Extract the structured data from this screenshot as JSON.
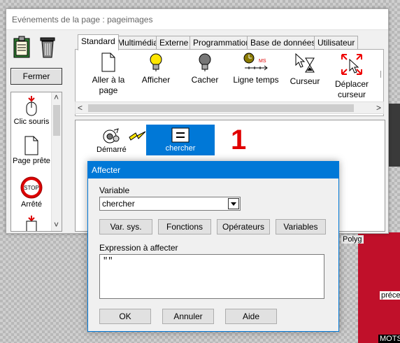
{
  "background": {
    "right_labels": [
      "Polyg",
      "préce",
      "MOTS"
    ]
  },
  "main_window": {
    "title": "Evénements de la page : pageimages",
    "fermer_label": "Fermer",
    "tabs": [
      "Standard",
      "Multimédia",
      "Externe",
      "Programmation",
      "Base de données",
      "Utilisateur"
    ],
    "tools": [
      {
        "label": "Aller à la page",
        "icon": "page-icon"
      },
      {
        "label": "Afficher",
        "icon": "lightbulb-on-icon"
      },
      {
        "label": "Cacher",
        "icon": "lightbulb-off-icon"
      },
      {
        "label": "Ligne temps",
        "icon": "timeline-icon"
      },
      {
        "label": "Curseur",
        "icon": "hourglass-cursor-icon"
      },
      {
        "label": "Déplacer curseur",
        "icon": "move-cursor-icon"
      }
    ],
    "left_items": [
      {
        "label": "Clic souris",
        "icon": "mouse-click-icon"
      },
      {
        "label": "Page prête",
        "icon": "page-ready-icon"
      },
      {
        "label": "Arrêté",
        "icon": "stop-sign-icon",
        "sign_text": "STOP"
      }
    ],
    "events": {
      "start_label": "Démarré",
      "action_label": "chercher",
      "number_label": "1"
    }
  },
  "dialog": {
    "title": "Affecter",
    "variable_label": "Variable",
    "variable_value": "chercher",
    "buttons": [
      "Var. sys.",
      "Fonctions",
      "Opérateurs",
      "Variables"
    ],
    "expression_label": "Expression à affecter",
    "expression_value": "\"\"",
    "ok_label": "OK",
    "cancel_label": "Annuler",
    "help_label": "Aide"
  },
  "colors": {
    "accent": "#0078d7",
    "number": "#e00000"
  }
}
